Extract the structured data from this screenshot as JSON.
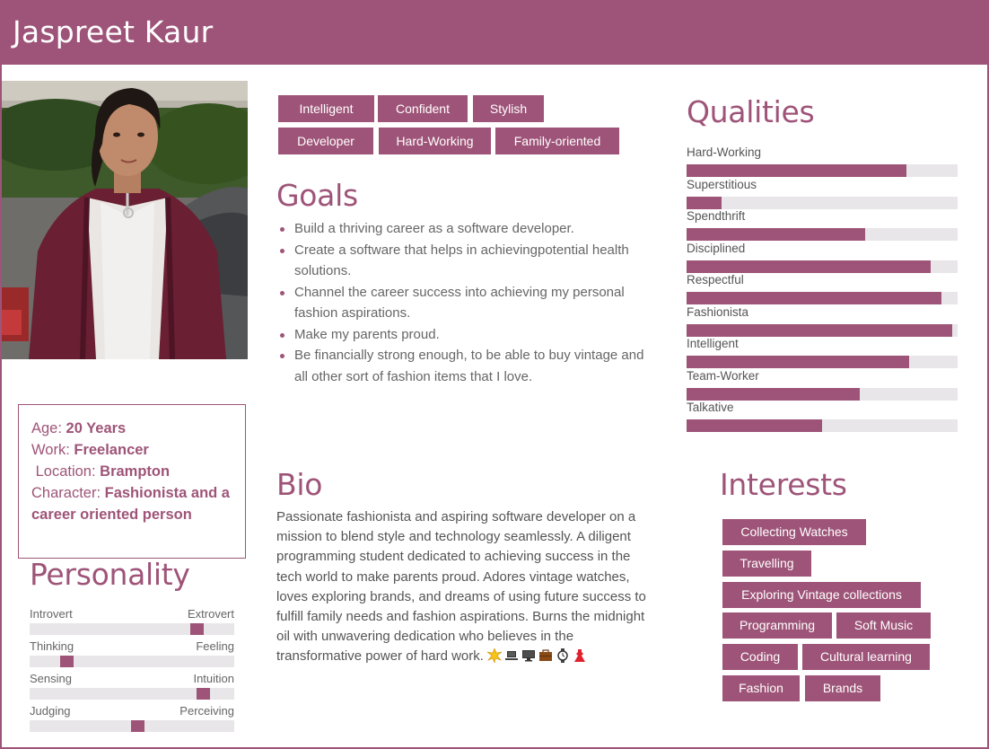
{
  "header": {
    "name": "Jaspreet Kaur"
  },
  "info": {
    "age_label": "Age:",
    "age_value": "20 Years",
    "work_label": "Work:",
    "work_value": "Freelancer",
    "location_label": "Location:",
    "location_value": "Brampton",
    "character_label": "Character:",
    "character_value": "Fashionista and a career oriented person"
  },
  "tags": [
    "Intelligent",
    "Confident",
    "Stylish",
    "Developer",
    "Hard-Working",
    "Family-oriented"
  ],
  "goals": {
    "title": "Goals",
    "items": [
      "Build a thriving career as a software developer.",
      "Create a software that helps in achievingpotential health solutions.",
      "Channel the career success into achieving my personal fashion aspirations.",
      "Make my parents proud.",
      "Be financially strong enough, to be able to buy vintage and all other sort of fashion items that I love."
    ]
  },
  "bio": {
    "title": "Bio",
    "text": "Passionate fashionista and aspiring software developer on a mission to blend style and technology seamlessly. A diligent programming student dedicated to achieving success in the tech world to make parents proud. Adores vintage watches, loves exploring brands, and dreams of using future success to fulfill family needs and fashion aspirations. Burns the midnight oil with unwavering dedication who believes in the transformative power of hard work.",
    "emojis": [
      "sparkle-burst-icon",
      "laptop-icon",
      "desktop-monitor-icon",
      "briefcase-icon",
      "watch-icon",
      "dress-icon"
    ]
  },
  "personality": {
    "title": "Personality",
    "traits": [
      {
        "left": "Introvert",
        "right": "Extrovert",
        "value": 0.82
      },
      {
        "left": "Thinking",
        "right": "Feeling",
        "value": 0.18
      },
      {
        "left": "Sensing",
        "right": "Intuition",
        "value": 0.85
      },
      {
        "left": "Judging",
        "right": "Perceiving",
        "value": 0.53
      }
    ]
  },
  "qualities": {
    "title": "Qualities",
    "items": [
      {
        "label": "Hard-Working",
        "value": 0.81
      },
      {
        "label": "Superstitious",
        "value": 0.13
      },
      {
        "label": "Spendthrift",
        "value": 0.66
      },
      {
        "label": "Disciplined",
        "value": 0.9
      },
      {
        "label": "Respectful",
        "value": 0.94
      },
      {
        "label": "Fashionista",
        "value": 0.98
      },
      {
        "label": "Intelligent",
        "value": 0.82
      },
      {
        "label": "Team-Worker",
        "value": 0.64
      },
      {
        "label": "Talkative",
        "value": 0.5
      }
    ]
  },
  "interests": {
    "title": "Interests",
    "items": [
      "Collecting Watches",
      "Travelling",
      "Exploring Vintage collections",
      "Programming",
      "Soft Music",
      "Coding",
      "Cultural learning",
      "Fashion",
      "Brands"
    ]
  },
  "colors": {
    "accent": "#9e5478",
    "track": "#e8e6e8"
  }
}
